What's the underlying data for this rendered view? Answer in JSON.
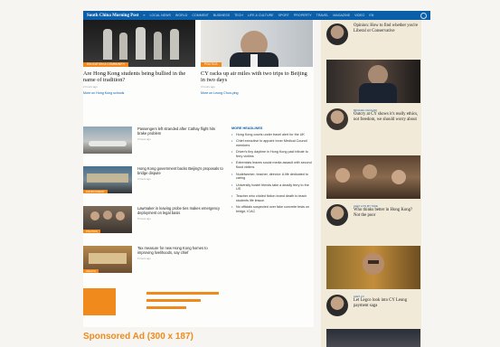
{
  "nav": {
    "logo": "South China Morning Post",
    "items": [
      "≡",
      "LOCAL NEWS",
      "WORLD",
      "COMMENT",
      "BUSINESS",
      "TECH",
      "LIFE & CULTURE",
      "SPORT",
      "PROPERTY",
      "TRAVEL",
      "MAGAZINE",
      "VIDEO",
      "EN"
    ]
  },
  "featured": [
    {
      "tag": "EDUCATION & COMMUNITY",
      "headline": "Are Hong Kong students being bullied in the name of tradition?",
      "meta": "2 hours ago",
      "more": "More on Hong Kong schools"
    },
    {
      "tag": "POLITICS",
      "headline": "CY racks up air miles with two trips to Beijing in two days",
      "meta": "3 hours ago",
      "more": "More on Leung Chun-ying"
    }
  ],
  "stories": [
    {
      "tag": "",
      "text": "Passengers left stranded after Cathay flight hits brake problem",
      "meta": "3 hours ago"
    },
    {
      "tag": "ENVIRONMENT",
      "text": "Hong Kong government backs Beijing's proposals to bridge dispute",
      "meta": "4 hours ago"
    },
    {
      "tag": "POLITICS",
      "text": "Lawmaker in leaving probe ties makes emergency deployment on legal basis",
      "meta": "5 hours ago"
    },
    {
      "tag": "HEALTH",
      "text": "Tax measure for new Hong Kong homes to improving livelihoods, say chief",
      "meta": "6 hours ago"
    }
  ],
  "more_headlines": {
    "heading": "MORE HEADLINES",
    "items": [
      "Hong Kong courts under travel alert for the UK",
      "Chief executive to appoint Inner Medical Council members",
      "Driver's tiny daytime in Hong Kong paid tribute to ferry victims",
      "Extremists leaves social media assault with second flood victims",
      "Nudelworker, teacher, director: A life dedicated to caring",
      "University hostel friends take a deadly ferry to the US",
      "Teacher who chided fiction brand death to teach students life lesson",
      "No officials suspected over fake concrete tests on bridge, ICAC"
    ]
  },
  "sidebar": {
    "columns": [
      {
        "label": "",
        "headline": "Opinion: How to find whether you're Liberal or Conservative",
        "meta": ""
      },
      {
        "label": "MICHAEL CHUGANI",
        "headline": "Outcry at CY shows it's really ethics, not freedom, we should worry about",
        "meta": ""
      },
      {
        "label": "ALEX LO'S MY TAKE",
        "headline": "Who thinks better in Hong Kong? Not the poor",
        "meta": ""
      },
      {
        "label": "ALEX LO",
        "headline": "Let Legco look into CY Leung payment saga",
        "meta": ""
      }
    ]
  },
  "sponsored": "Sponsored Ad (300 x 187)",
  "colors": {
    "brand": "#0b5ea8",
    "accent": "#f08a1c"
  }
}
